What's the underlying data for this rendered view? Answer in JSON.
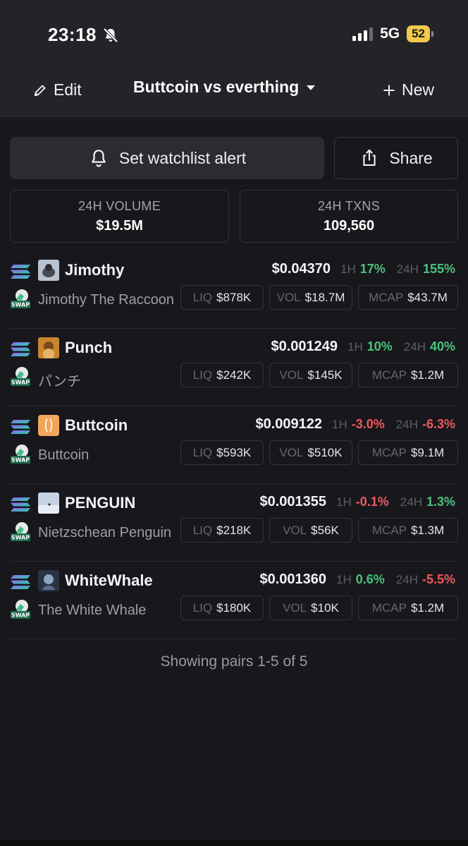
{
  "status_bar": {
    "time": "23:18",
    "network": "5G",
    "battery": "52"
  },
  "nav": {
    "edit_label": "Edit",
    "title": "Buttcoin vs everthing",
    "new_label": "New"
  },
  "actions": {
    "alert_label": "Set watchlist alert",
    "share_label": "Share"
  },
  "stats": {
    "volume_label": "24H VOLUME",
    "volume_value": "$19.5M",
    "txns_label": "24H TXNS",
    "txns_value": "109,560"
  },
  "labels": {
    "h1": "1H",
    "h24": "24H",
    "liq": "LIQ",
    "vol": "VOL",
    "mcap": "MCAP",
    "swap": "SWAP"
  },
  "pairs": [
    {
      "symbol": "Jimothy",
      "name": "Jimothy The Raccoon",
      "price": "$0.04370",
      "change_1h": "17%",
      "change_24h": "155%",
      "liq": "$878K",
      "vol": "$18.7M",
      "mcap": "$43.7M",
      "trend_1h": "up",
      "trend_24h": "up"
    },
    {
      "symbol": "Punch",
      "name": "パンチ",
      "price": "$0.001249",
      "change_1h": "10%",
      "change_24h": "40%",
      "liq": "$242K",
      "vol": "$145K",
      "mcap": "$1.2M",
      "trend_1h": "up",
      "trend_24h": "up"
    },
    {
      "symbol": "Buttcoin",
      "name": "Buttcoin",
      "price": "$0.009122",
      "change_1h": "-3.0%",
      "change_24h": "-6.3%",
      "liq": "$593K",
      "vol": "$510K",
      "mcap": "$9.1M",
      "trend_1h": "down",
      "trend_24h": "down"
    },
    {
      "symbol": "PENGUIN",
      "name": "Nietzschean Penguin",
      "price": "$0.001355",
      "change_1h": "-0.1%",
      "change_24h": "1.3%",
      "liq": "$218K",
      "vol": "$56K",
      "mcap": "$1.3M",
      "trend_1h": "down",
      "trend_24h": "up"
    },
    {
      "symbol": "WhiteWhale",
      "name": "The White Whale",
      "price": "$0.001360",
      "change_1h": "0.6%",
      "change_24h": "-5.5%",
      "liq": "$180K",
      "vol": "$10K",
      "mcap": "$1.2M",
      "trend_1h": "up",
      "trend_24h": "down"
    }
  ],
  "footer": "Showing pairs 1-5 of 5",
  "colors": {
    "up": "#4cc27a",
    "down": "#f0595a",
    "battery": "#f2c94c"
  },
  "icons": {
    "bell_off": "bell-slash-icon",
    "pencil": "pencil-icon",
    "caret": "caret-down-icon",
    "plus": "plus-icon",
    "bell": "bell-icon",
    "share": "share-icon",
    "chain": "solana-icon",
    "swap": "swap-icon"
  }
}
